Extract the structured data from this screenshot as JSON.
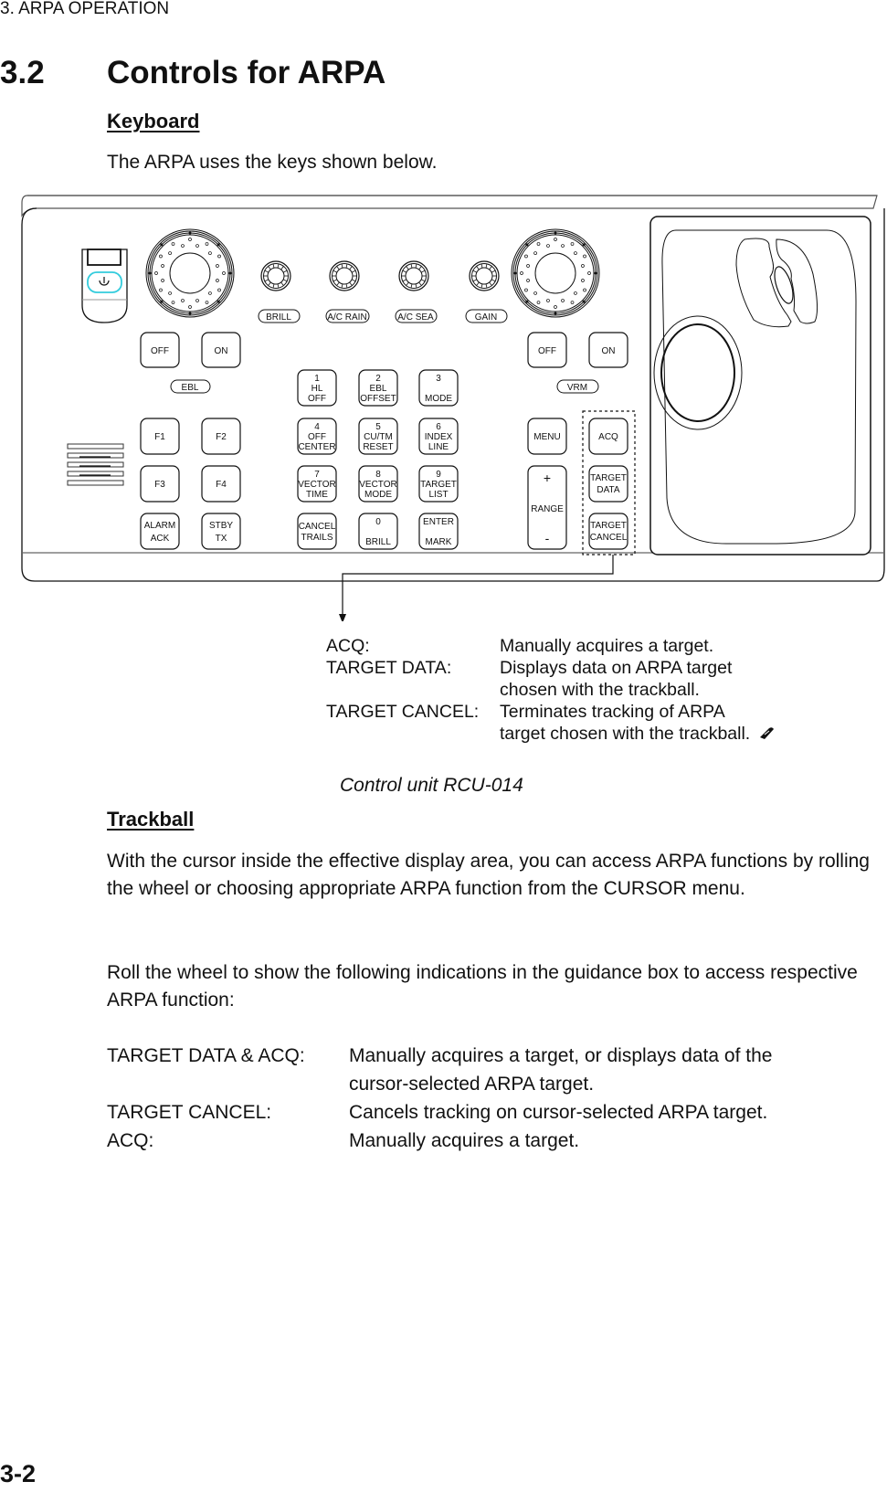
{
  "running_head": "3. ARPA OPERATION",
  "section": {
    "number": "3.2",
    "title": "Controls for ARPA"
  },
  "keyboard": {
    "heading": "Keyboard",
    "intro": "The ARPA uses the keys shown below."
  },
  "panel": {
    "knob_labels": [
      "BRILL",
      "A/C RAIN",
      "A/C SEA",
      "GAIN"
    ],
    "ebl": {
      "off": "OFF",
      "on": "ON",
      "label": "EBL"
    },
    "vrm": {
      "off": "OFF",
      "on": "ON",
      "label": "VRM"
    },
    "function_keys": [
      "F1",
      "F2",
      "F3",
      "F4"
    ],
    "alarm_ack": [
      "ALARM",
      "ACK"
    ],
    "stby_tx": [
      "STBY",
      "TX"
    ],
    "numpad": [
      [
        "1",
        "HL",
        "OFF"
      ],
      [
        "2",
        "EBL",
        "OFFSET"
      ],
      [
        "3",
        "",
        "MODE"
      ],
      [
        "4",
        "OFF",
        "CENTER"
      ],
      [
        "5",
        "CU/TM",
        "RESET"
      ],
      [
        "6",
        "INDEX",
        "LINE"
      ],
      [
        "7",
        "VECTOR",
        "TIME"
      ],
      [
        "8",
        "VECTOR",
        "MODE"
      ],
      [
        "9",
        "TARGET",
        "LIST"
      ],
      [
        "",
        "CANCEL",
        "TRAILS"
      ],
      [
        "0",
        "",
        "BRILL"
      ],
      [
        "ENTER",
        "",
        "MARK"
      ]
    ],
    "menu": "MENU",
    "range": {
      "plus": "+",
      "label": "RANGE",
      "minus": "-"
    },
    "acq": "ACQ",
    "target_data": [
      "TARGET",
      "DATA"
    ],
    "target_cancel": [
      "TARGET",
      "CANCEL"
    ],
    "power_icon_color": "#33ccdd"
  },
  "key_descriptions": [
    {
      "label": "ACQ:",
      "lines": [
        "Manually acquires a target."
      ]
    },
    {
      "label": "TARGET DATA:",
      "lines": [
        "Displays data on ARPA target",
        "chosen with the trackball."
      ]
    },
    {
      "label": "TARGET CANCEL:",
      "lines": [
        "Terminates tracking of ARPA",
        "target chosen with the trackball."
      ]
    }
  ],
  "caption": "Control unit RCU-014",
  "trackball": {
    "heading": "Trackball",
    "para1": "With the cursor inside the effective display area, you can access ARPA functions by rolling the wheel or choosing appropriate ARPA function from the CURSOR menu.",
    "para2": "Roll the wheel to show the following indications in the guidance box to access respective ARPA function:",
    "functions": [
      {
        "label": "TARGET DATA & ACQ:",
        "lines": [
          "Manually acquires a target, or displays data of the",
          "cursor-selected ARPA target."
        ]
      },
      {
        "label": "TARGET CANCEL:",
        "lines": [
          "Cancels tracking on cursor-selected ARPA target."
        ]
      },
      {
        "label": "ACQ:",
        "lines": [
          "Manually acquires a target."
        ]
      }
    ]
  },
  "page_number": "3-2"
}
